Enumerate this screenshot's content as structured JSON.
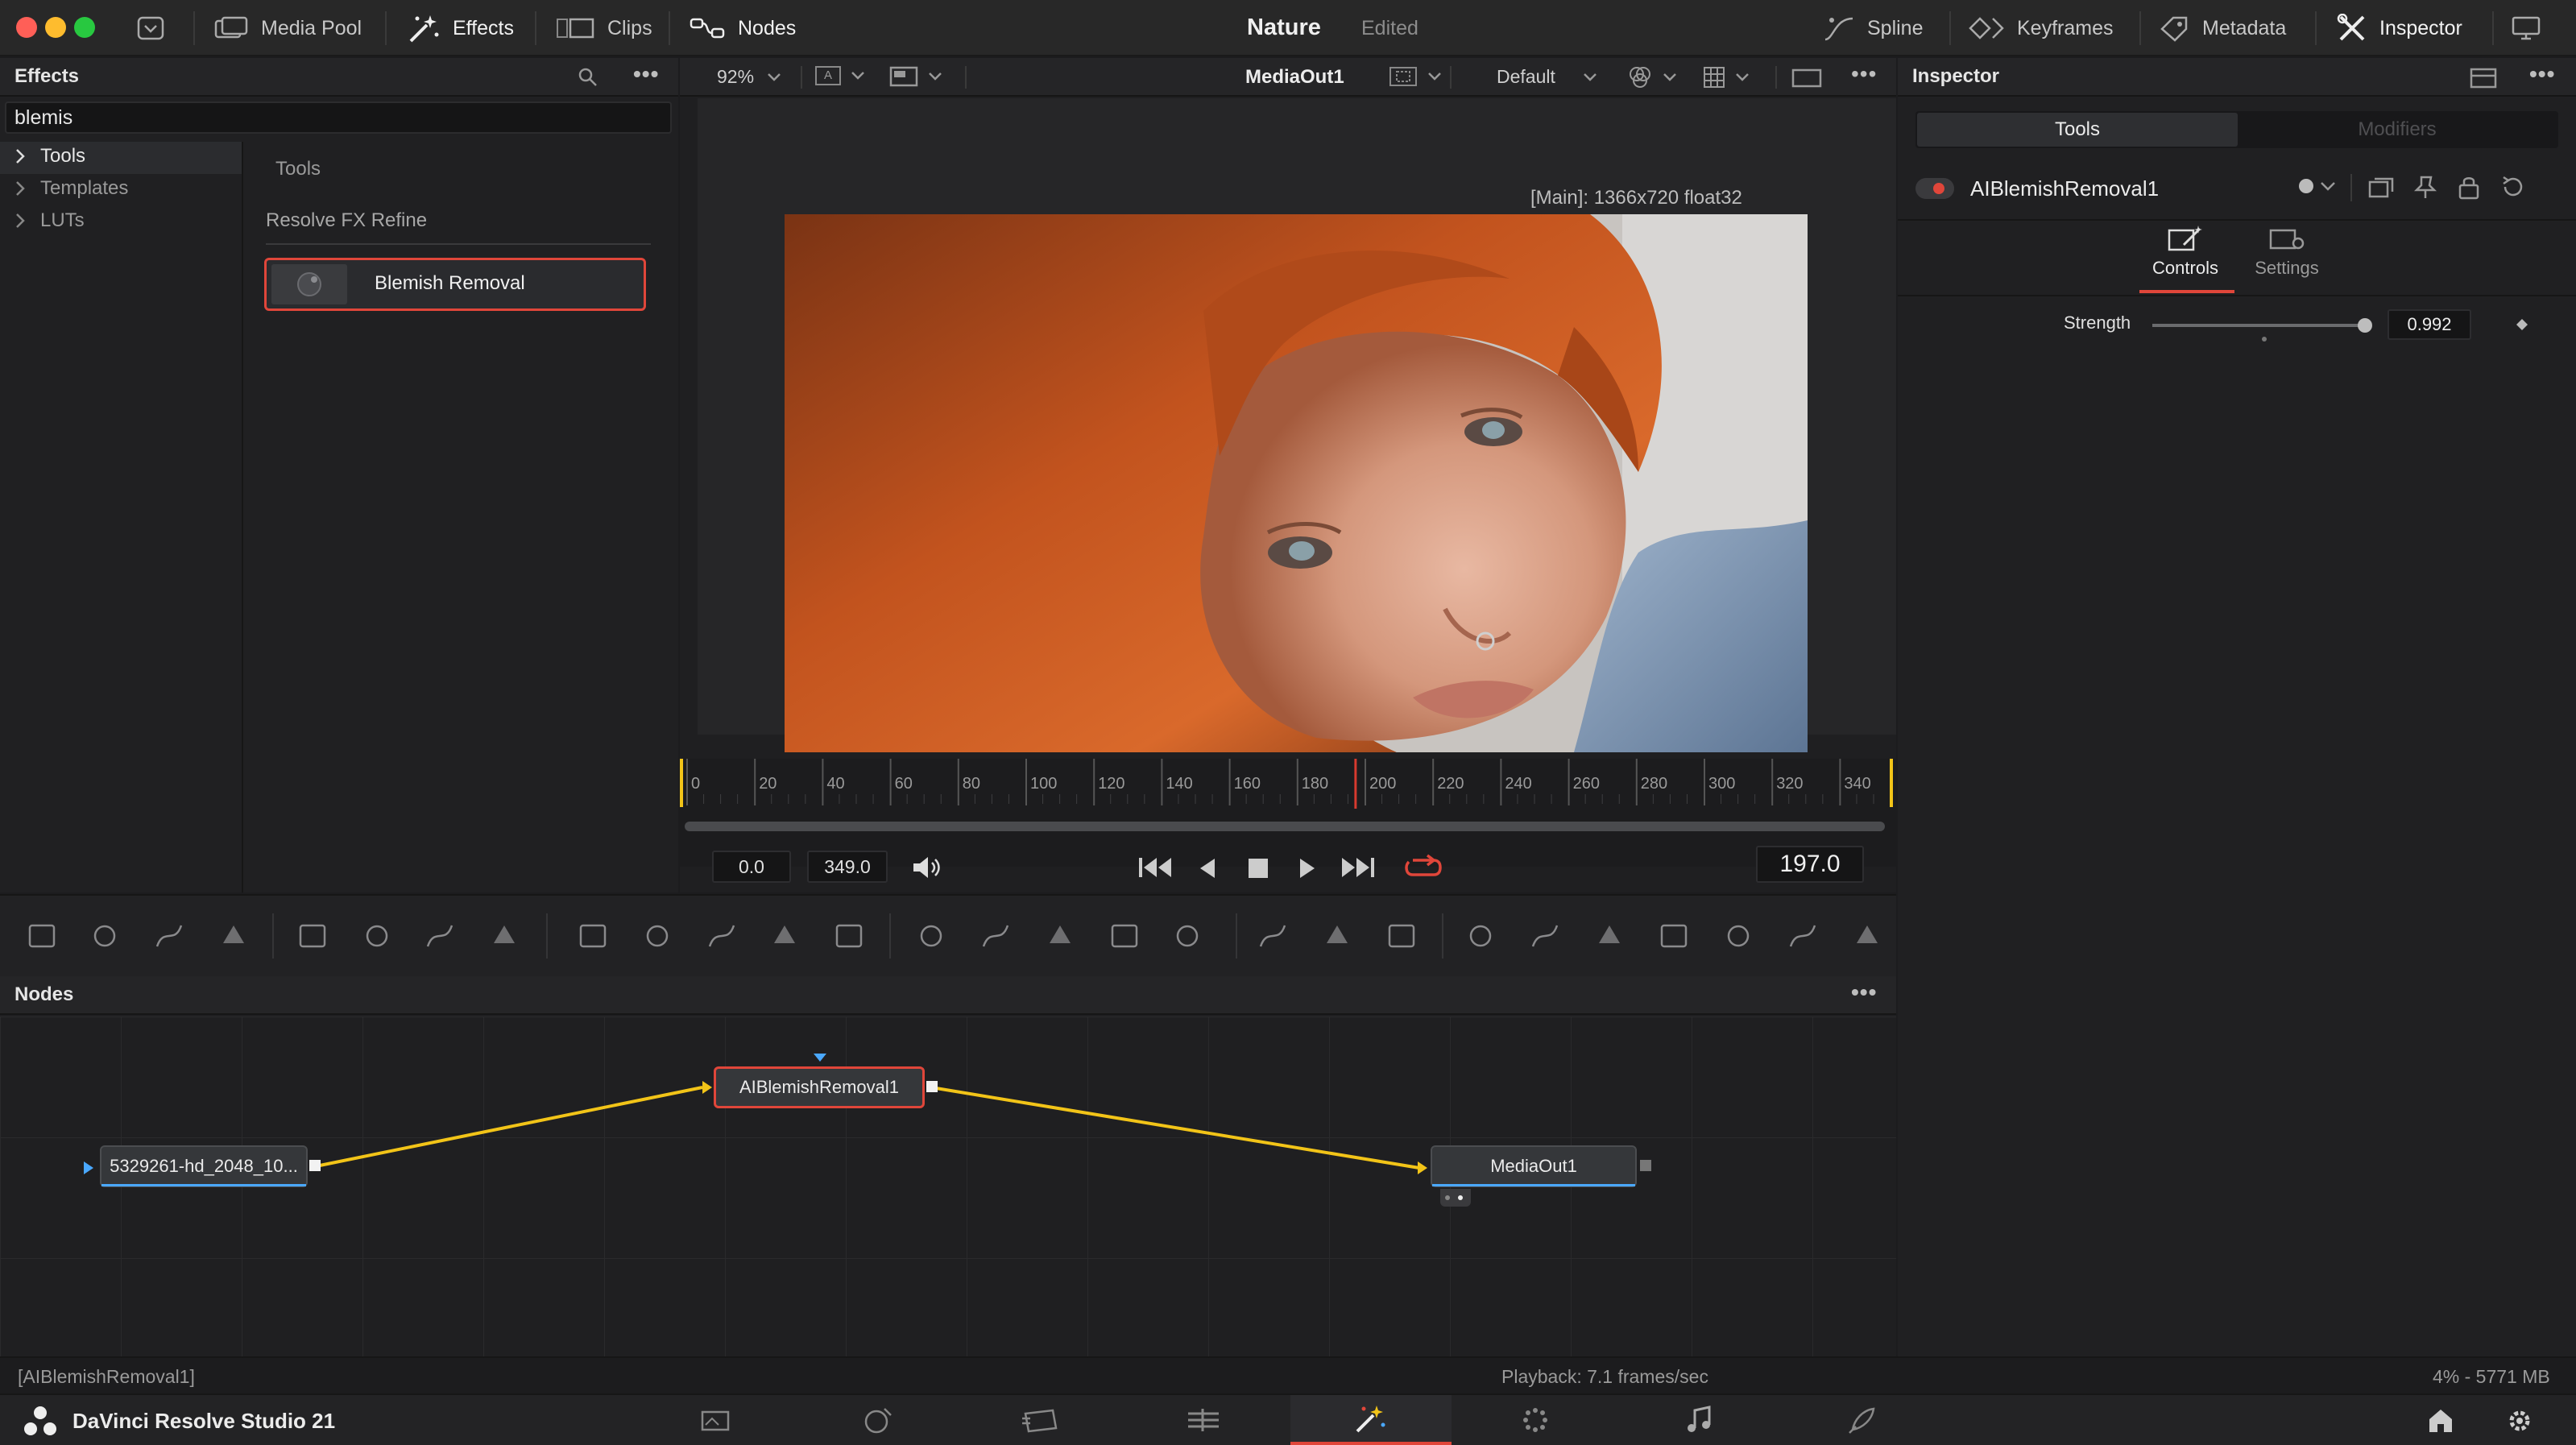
{
  "window": {
    "project_title": "Nature",
    "project_status": "Edited"
  },
  "toolbar": {
    "left": [
      "Media Pool",
      "Effects",
      "Clips",
      "Nodes"
    ],
    "right": [
      "Spline",
      "Keyframes",
      "Metadata",
      "Inspector"
    ]
  },
  "effects_panel": {
    "title": "Effects",
    "search_value": "blemis",
    "tree": [
      "Tools",
      "Templates",
      "LUTs"
    ],
    "content_header": "Tools",
    "category": "Resolve FX Refine",
    "result": "Blemish Removal"
  },
  "viewer": {
    "zoom": "92%",
    "a_label": "A",
    "output_name": "MediaOut1",
    "lut": "Default",
    "info": "[Main]: 1366x720 float32",
    "ruler_ticks": [
      "0",
      "20",
      "40",
      "60",
      "80",
      "100",
      "120",
      "140",
      "160",
      "180",
      "200",
      "220",
      "240",
      "260",
      "280",
      "300",
      "320",
      "340"
    ],
    "playhead_frame": 197,
    "range_start": "0.0",
    "range_end": "349.0",
    "current_frame": "197.0"
  },
  "inspector": {
    "title": "Inspector",
    "tabs": [
      "Tools",
      "Modifiers"
    ],
    "tool_name": "AIBlemishRemoval1",
    "subtabs": [
      "Controls",
      "Settings"
    ],
    "strength_label": "Strength",
    "strength_value": "0.992",
    "strength_fraction": 0.992
  },
  "nodes_panel": {
    "title": "Nodes",
    "nodes": {
      "source": "5329261-hd_2048_10...",
      "effect": "AIBlemishRemoval1",
      "output": "MediaOut1"
    }
  },
  "status_bar": {
    "selected": "[AIBlemishRemoval1]",
    "playback": "Playback: 7.1 frames/sec",
    "memory": "4% - 5771 MB"
  },
  "app": {
    "name": "DaVinci Resolve Studio 21"
  },
  "colors": {
    "accent_red": "#e0463a",
    "link_yellow": "#f2c418",
    "playhead": "#d63a2f"
  }
}
